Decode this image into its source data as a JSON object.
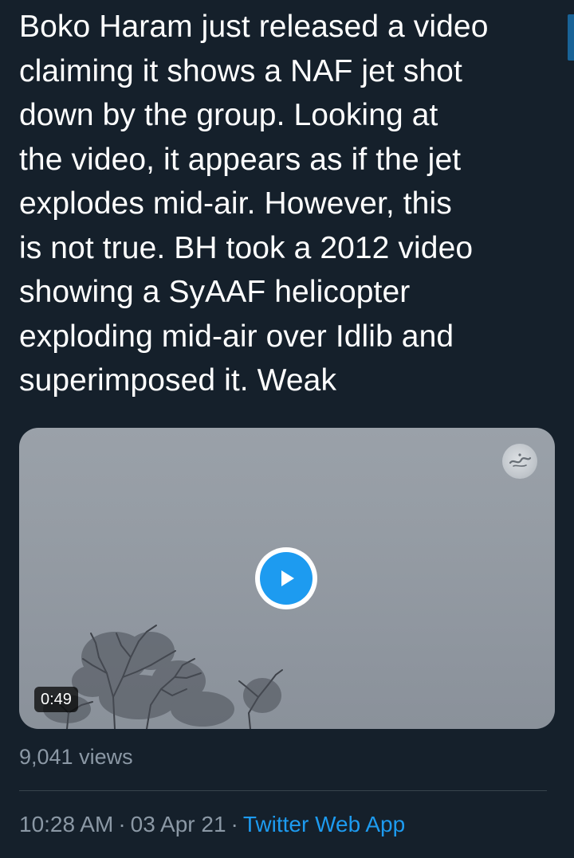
{
  "tweet": {
    "text": "Boko Haram just released a video\nclaiming it shows a NAF jet shot\ndown by the group. Looking at\nthe video, it appears as if the jet\nexplodes mid-air. However, this\nis not true. BH took a 2012 video\nshowing a SyAAF helicopter\nexploding mid-air over Idlib and\nsuperimposed it. Weak"
  },
  "media": {
    "duration": "0:49",
    "play_icon": "play-icon",
    "watermark_icon": "logo-watermark-icon"
  },
  "stats": {
    "views": "9,041 views"
  },
  "meta": {
    "time": "10:28 AM",
    "separator": "·",
    "date": "03 Apr 21",
    "app": "Twitter Web App"
  },
  "colors": {
    "background": "#15202b",
    "text": "#ffffff",
    "secondary": "#8b98a5",
    "accent": "#1d9bf0"
  }
}
